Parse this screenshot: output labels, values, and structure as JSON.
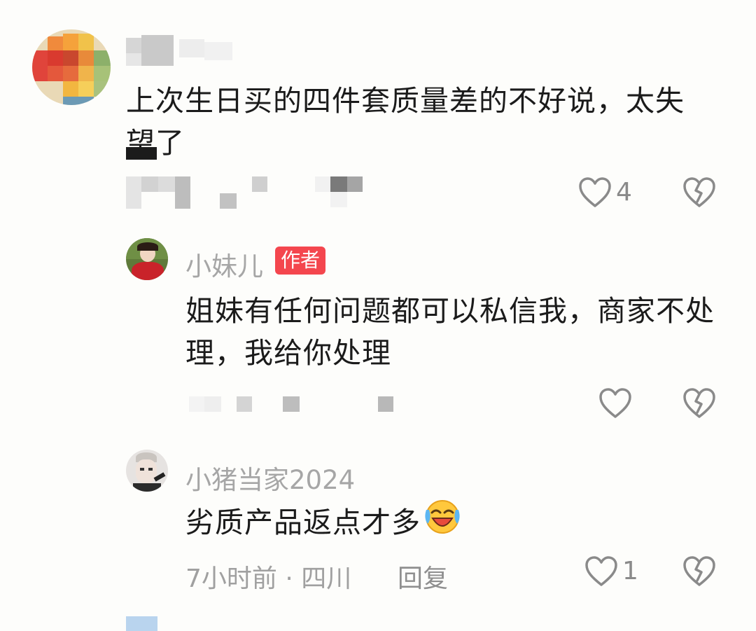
{
  "comments": [
    {
      "username": "",
      "text": "上次生日买的四件套质量差的不好说，太失望了",
      "like_count": "4",
      "is_author": false
    },
    {
      "username": "小妹儿",
      "badge": "作者",
      "text": "姐妹有任何问题都可以私信我，商家不处理，我给你处理",
      "like_count": "",
      "is_author": true
    },
    {
      "username": "小猪当家2024",
      "text": "劣质产品返点才多",
      "emoji": "laughing-crying-emoji",
      "time_location": "7小时前 · 四川",
      "reply_label": "回复",
      "like_count": "1",
      "is_author": false
    }
  ],
  "icons": {
    "like": "heart-outline-icon",
    "dislike": "broken-heart-icon"
  },
  "colors": {
    "author_badge": "#f4464e",
    "username": "#a6a6a6",
    "body_text": "#1b1b1b",
    "icon": "#8a8a8a"
  }
}
